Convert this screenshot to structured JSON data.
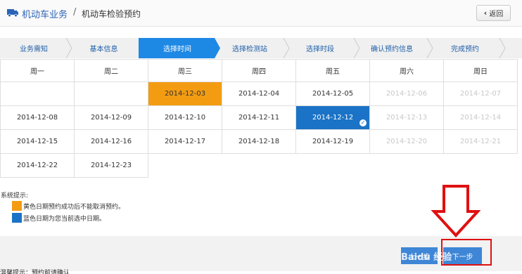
{
  "header": {
    "title": "机动车业务",
    "separator": "/",
    "subtitle": "机动车检验预约",
    "back_label": "返回"
  },
  "steps": [
    {
      "label": "业务需知",
      "active": false
    },
    {
      "label": "基本信息",
      "active": false
    },
    {
      "label": "选择时间",
      "active": true
    },
    {
      "label": "选择检测站",
      "active": false
    },
    {
      "label": "选择时段",
      "active": false
    },
    {
      "label": "确认预约信息",
      "active": false
    },
    {
      "label": "完成预约",
      "active": false
    }
  ],
  "calendar": {
    "weekdays": [
      "周一",
      "周二",
      "周三",
      "周四",
      "周五",
      "周六",
      "周日"
    ],
    "rows": [
      [
        {
          "date": "",
          "state": "blank"
        },
        {
          "date": "",
          "state": "blank"
        },
        {
          "date": "2014-12-03",
          "state": "orange"
        },
        {
          "date": "2014-12-04",
          "state": "normal"
        },
        {
          "date": "2014-12-05",
          "state": "normal"
        },
        {
          "date": "2014-12-06",
          "state": "disabled"
        },
        {
          "date": "2014-12-07",
          "state": "disabled"
        }
      ],
      [
        {
          "date": "2014-12-08",
          "state": "normal"
        },
        {
          "date": "2014-12-09",
          "state": "normal"
        },
        {
          "date": "2014-12-10",
          "state": "normal"
        },
        {
          "date": "2014-12-11",
          "state": "normal"
        },
        {
          "date": "2014-12-12",
          "state": "selected"
        },
        {
          "date": "2014-12-13",
          "state": "disabled"
        },
        {
          "date": "2014-12-14",
          "state": "disabled"
        }
      ],
      [
        {
          "date": "2014-12-15",
          "state": "normal"
        },
        {
          "date": "2014-12-16",
          "state": "normal"
        },
        {
          "date": "2014-12-17",
          "state": "normal"
        },
        {
          "date": "2014-12-18",
          "state": "normal"
        },
        {
          "date": "2014-12-19",
          "state": "normal"
        },
        {
          "date": "2014-12-20",
          "state": "disabled"
        },
        {
          "date": "2014-12-21",
          "state": "disabled"
        }
      ],
      [
        {
          "date": "2014-12-22",
          "state": "normal"
        },
        {
          "date": "2014-12-23",
          "state": "normal"
        },
        {
          "date": "",
          "state": "empty"
        },
        {
          "date": "",
          "state": "empty"
        },
        {
          "date": "",
          "state": "empty"
        },
        {
          "date": "",
          "state": "empty"
        },
        {
          "date": "",
          "state": "empty"
        }
      ]
    ]
  },
  "tips": {
    "title": "系统提示:",
    "items": [
      {
        "color": "#f39c12",
        "text": "黄色日期预约成功后不能取消预约。"
      },
      {
        "color": "#1a73c6",
        "text": "蓝色日期为您当前选中日期。"
      }
    ]
  },
  "footer": {
    "prev_label": "上一步",
    "next_label": "下一步",
    "bottom_text": "温馨提示：预约前请确认"
  },
  "watermark": "Baidu 经验",
  "watermark_sub": "jingyan.baidu.com",
  "colors": {
    "accent_blue": "#1e88e5",
    "selected_blue": "#1a73c6",
    "orange": "#f39c12",
    "annotation_red": "#e01010"
  },
  "icons": {
    "truck": "truck-icon",
    "check": "check-icon",
    "arrow": "down-arrow-annotation"
  }
}
